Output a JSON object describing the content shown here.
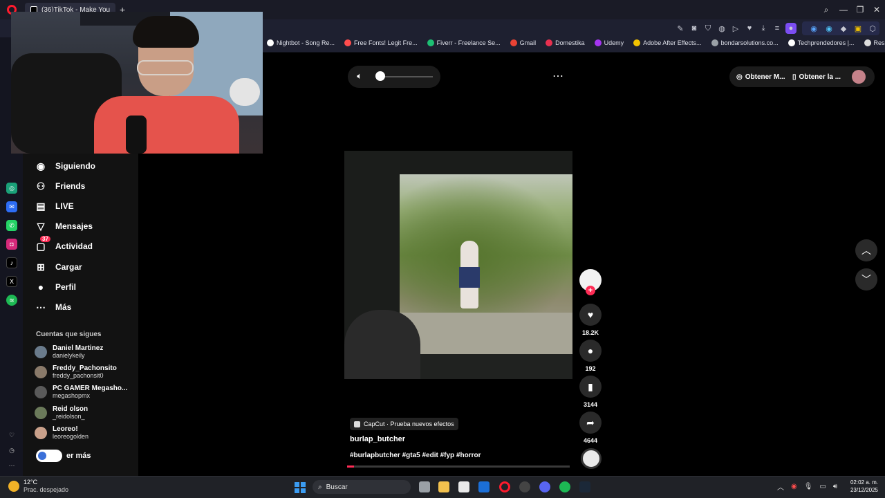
{
  "browser": {
    "active_tab_title": "(36)TikTok - Make You",
    "bookmarks": [
      {
        "label": "Nightbot - Song Re...",
        "color": "#ffffff"
      },
      {
        "label": "Free Fonts! Legit Fre...",
        "color": "#ff4d4d"
      },
      {
        "label": "Fiverr - Freelance Se...",
        "color": "#1dbf73"
      },
      {
        "label": "Gmail",
        "color": "#ea4335"
      },
      {
        "label": "Domestika",
        "color": "#e8304f"
      },
      {
        "label": "Udemy",
        "color": "#a435f0"
      },
      {
        "label": "Adobe After Effects...",
        "color": "#f2c200"
      },
      {
        "label": "bondarsolutions.co...",
        "color": "#9aa0a6"
      },
      {
        "label": "Techprendedores |...",
        "color": "#ffffff"
      },
      {
        "label": "Resumen",
        "color": "#dddddd"
      }
    ]
  },
  "tiktok": {
    "nav": [
      {
        "label": "Siguiendo",
        "icon": "following-avatar-icon"
      },
      {
        "label": "Friends",
        "icon": "friends-icon"
      },
      {
        "label": "LIVE",
        "icon": "live-icon"
      },
      {
        "label": "Mensajes",
        "icon": "messages-icon"
      },
      {
        "label": "Actividad",
        "icon": "activity-icon",
        "badge": "37"
      },
      {
        "label": "Cargar",
        "icon": "upload-icon"
      },
      {
        "label": "Perfil",
        "icon": "profile-icon"
      },
      {
        "label": "Más",
        "icon": "more-icon"
      }
    ],
    "following_title": "Cuentas que sigues",
    "accounts": [
      {
        "name": "Daniel Martinez",
        "handle": "danielykeily"
      },
      {
        "name": "Freddy_Pachonsito",
        "handle": "freddy_pachonsit0"
      },
      {
        "name": "PC GAMER Megasho...",
        "handle": "megashopmx"
      },
      {
        "name": "Reid olson",
        "handle": "_reidolson_"
      },
      {
        "name": "Leoreo!",
        "handle": "leoreogolden"
      }
    ],
    "see_more": "er más",
    "top_right": {
      "btn1": "Obtener M...",
      "btn2": "Obtener la ..."
    },
    "video": {
      "effect_tag": "CapCut · Prueba nuevos efectos",
      "author": "burlap_butcher",
      "hashtags": "#burlapbutcher #gta5 #edit #fyp #horror",
      "progress": 0.03,
      "volume": 0.0
    },
    "actions": {
      "likes": "18.2K",
      "comments": "192",
      "saves": "3144",
      "shares": "4644"
    }
  },
  "taskbar": {
    "temperature": "12°C",
    "weather": "Prac. despejado",
    "search_placeholder": "Buscar",
    "time": "02:02 a. m.",
    "date": "23/12/2025"
  }
}
